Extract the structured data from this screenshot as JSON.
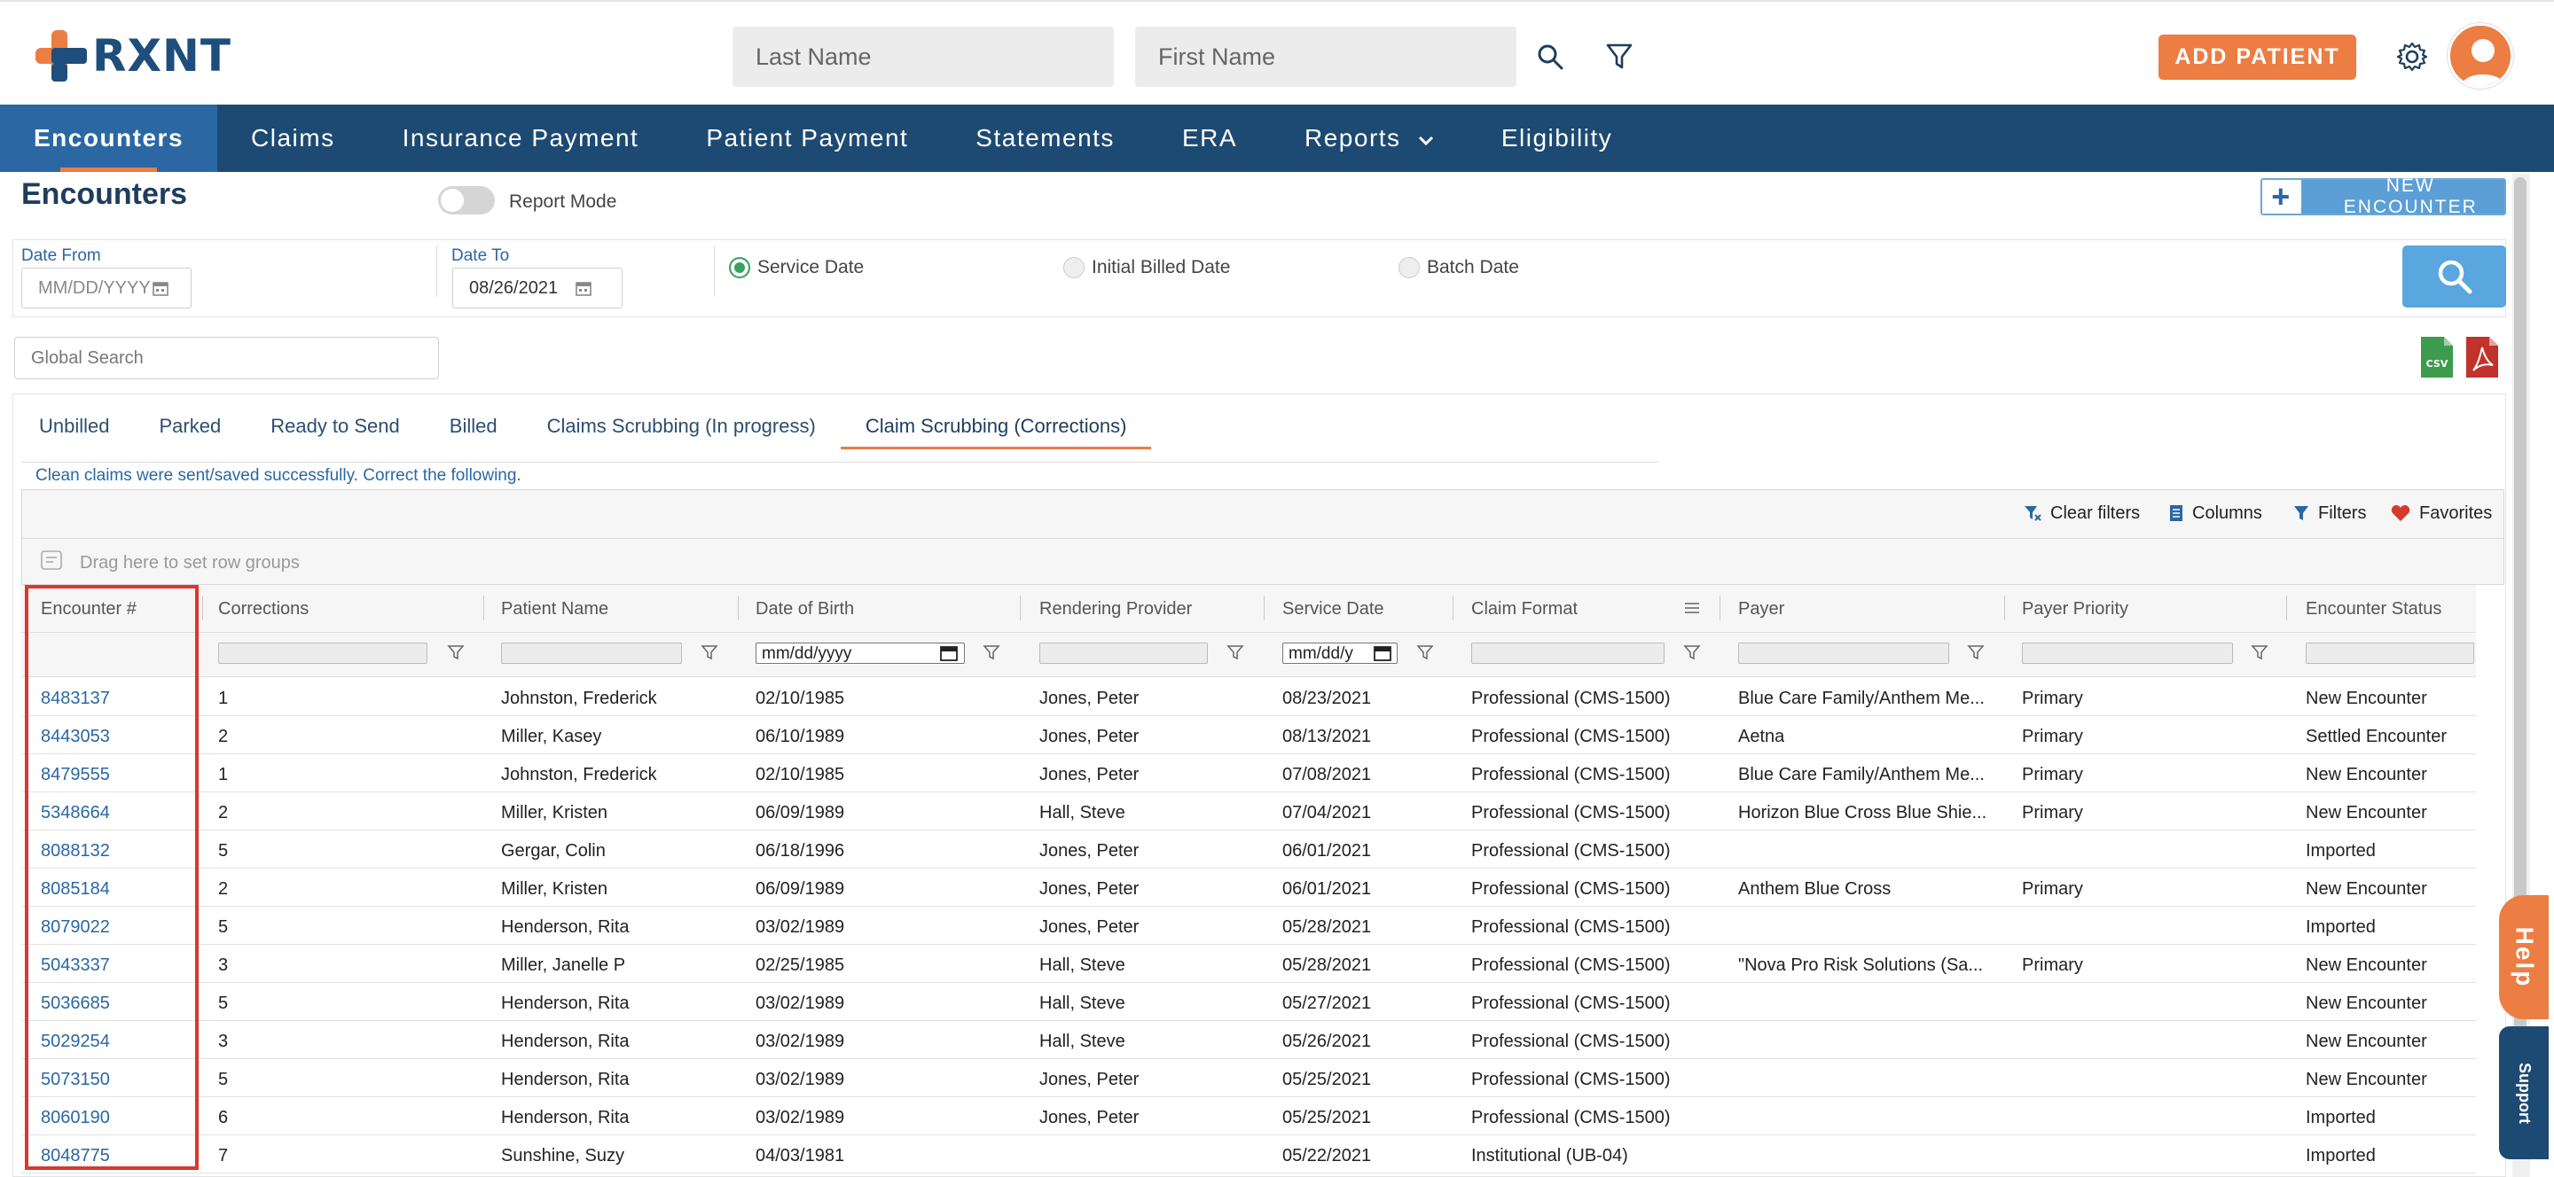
{
  "header": {
    "logo_text": "RXNT",
    "last_name_placeholder": "Last Name",
    "first_name_placeholder": "First Name",
    "add_patient_label": "ADD PATIENT"
  },
  "nav": {
    "items": [
      "Encounters",
      "Claims",
      "Insurance Payment",
      "Patient Payment",
      "Statements",
      "ERA",
      "Reports",
      "Eligibility"
    ],
    "active": "Encounters"
  },
  "page": {
    "title": "Encounters",
    "report_mode_label": "Report Mode",
    "new_encounter_label": "NEW ENCOUNTER"
  },
  "filters": {
    "date_from_label": "Date From",
    "date_from_placeholder": "MM/DD/YYYY",
    "date_to_label": "Date To",
    "date_to_value": "08/26/2021",
    "radios": [
      {
        "label": "Service Date",
        "selected": true
      },
      {
        "label": "Initial Billed Date",
        "selected": false
      },
      {
        "label": "Batch Date",
        "selected": false
      }
    ]
  },
  "global_search_placeholder": "Global Search",
  "tabs": [
    "Unbilled",
    "Parked",
    "Ready to Send",
    "Billed",
    "Claims Scrubbing (In progress)",
    "Claim Scrubbing (Corrections)"
  ],
  "active_tab": "Claim Scrubbing (Corrections)",
  "success_message": "Clean claims were sent/saved successfully. Correct the following.",
  "toolbar": {
    "clear_filters": "Clear filters",
    "columns": "Columns",
    "filters": "Filters",
    "favorites": "Favorites"
  },
  "group_placeholder": "Drag here to set row groups",
  "table": {
    "columns": [
      "Encounter #",
      "Corrections",
      "Patient Name",
      "Date of Birth",
      "Rendering Provider",
      "Service Date",
      "Claim Format",
      "Payer",
      "Payer Priority",
      "Encounter Status"
    ],
    "date_filter_placeholder": "mm/dd/yyyy",
    "service_date_filter_placeholder": "mm/dd/y",
    "rows": [
      [
        "8483137",
        "1",
        "Johnston, Frederick",
        "02/10/1985",
        "Jones, Peter",
        "08/23/2021",
        "Professional (CMS-1500)",
        "Blue Care Family/Anthem Me...",
        "Primary",
        "New Encounter"
      ],
      [
        "8443053",
        "2",
        "Miller, Kasey",
        "06/10/1989",
        "Jones, Peter",
        "08/13/2021",
        "Professional (CMS-1500)",
        "Aetna",
        "Primary",
        "Settled Encounter"
      ],
      [
        "8479555",
        "1",
        "Johnston, Frederick",
        "02/10/1985",
        "Jones, Peter",
        "07/08/2021",
        "Professional (CMS-1500)",
        "Blue Care Family/Anthem Me...",
        "Primary",
        "New Encounter"
      ],
      [
        "5348664",
        "2",
        "Miller, Kristen",
        "06/09/1989",
        "Hall, Steve",
        "07/04/2021",
        "Professional (CMS-1500)",
        "Horizon Blue Cross Blue Shie...",
        "Primary",
        "New Encounter"
      ],
      [
        "8088132",
        "5",
        "Gergar, Colin",
        "06/18/1996",
        "Jones, Peter",
        "06/01/2021",
        "Professional (CMS-1500)",
        "",
        "",
        "Imported"
      ],
      [
        "8085184",
        "2",
        "Miller, Kristen",
        "06/09/1989",
        "Jones, Peter",
        "06/01/2021",
        "Professional (CMS-1500)",
        "Anthem Blue Cross",
        "Primary",
        "New Encounter"
      ],
      [
        "8079022",
        "5",
        "Henderson, Rita",
        "03/02/1989",
        "Jones, Peter",
        "05/28/2021",
        "Professional (CMS-1500)",
        "",
        "",
        "Imported"
      ],
      [
        "5043337",
        "3",
        "Miller, Janelle P",
        "02/25/1985",
        "Hall, Steve",
        "05/28/2021",
        "Professional (CMS-1500)",
        "\"Nova Pro Risk Solutions (Sa...",
        "Primary",
        "New Encounter"
      ],
      [
        "5036685",
        "5",
        "Henderson, Rita",
        "03/02/1989",
        "Hall, Steve",
        "05/27/2021",
        "Professional (CMS-1500)",
        "",
        "",
        "New Encounter"
      ],
      [
        "5029254",
        "3",
        "Henderson, Rita",
        "03/02/1989",
        "Hall, Steve",
        "05/26/2021",
        "Professional (CMS-1500)",
        "",
        "",
        "New Encounter"
      ],
      [
        "5073150",
        "5",
        "Henderson, Rita",
        "03/02/1989",
        "Jones, Peter",
        "05/25/2021",
        "Professional (CMS-1500)",
        "",
        "",
        "New Encounter"
      ],
      [
        "8060190",
        "6",
        "Henderson, Rita",
        "03/02/1989",
        "Jones, Peter",
        "05/25/2021",
        "Professional (CMS-1500)",
        "",
        "",
        "Imported"
      ],
      [
        "8048775",
        "7",
        "Sunshine, Suzy",
        "04/03/1981",
        "",
        "05/22/2021",
        "Institutional (UB-04)",
        "",
        "",
        "Imported"
      ]
    ]
  },
  "side_tabs": {
    "help": "Help",
    "support": "Support"
  },
  "colors": {
    "brand_blue": "#1d4a72",
    "accent_orange": "#ec7d43",
    "link_blue": "#2b67a3",
    "highlight_red": "#d9382e"
  }
}
